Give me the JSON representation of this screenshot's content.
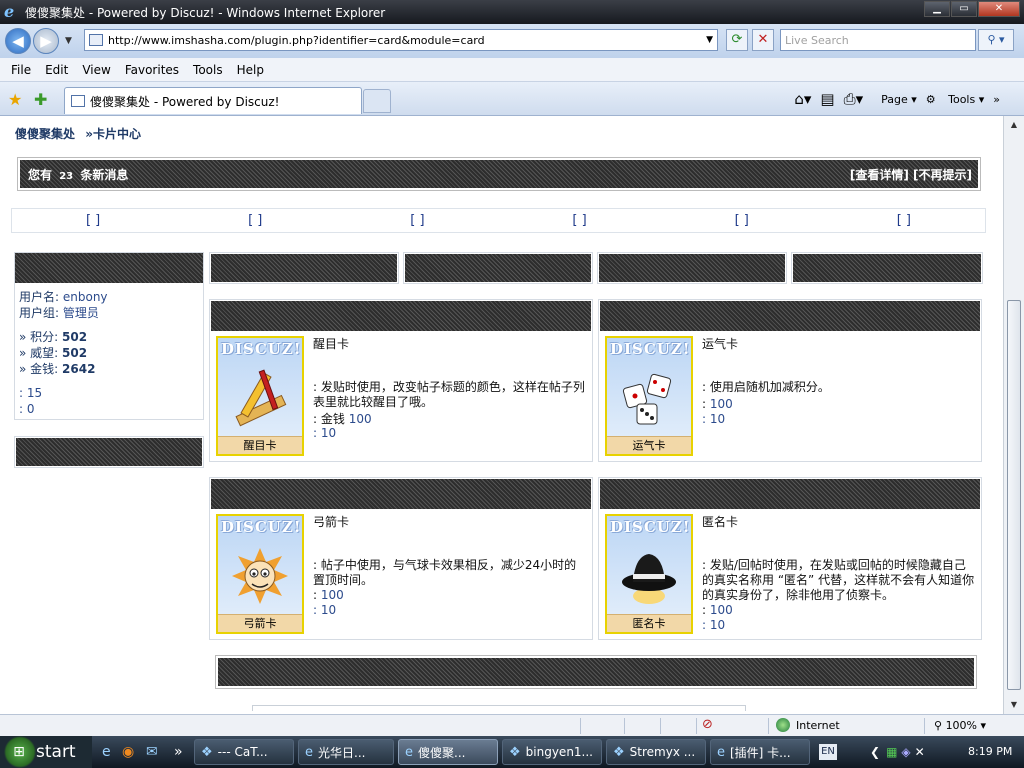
{
  "window": {
    "title": "傻傻聚集处 - Powered by Discuz! - Windows Internet Explorer"
  },
  "address": {
    "url": "http://www.imshasha.com/plugin.php?identifier=card&module=card",
    "search_placeholder": "Live Search"
  },
  "menu": [
    "File",
    "Edit",
    "View",
    "Favorites",
    "Tools",
    "Help"
  ],
  "tab": {
    "title": "傻傻聚集处 - Powered by Discuz!"
  },
  "commands": {
    "page": "Page",
    "tools": "Tools"
  },
  "breadcrumb": {
    "site": "傻傻聚集处",
    "page": "»卡片中心"
  },
  "message_bar": {
    "prefix": "您有",
    "count": "23",
    "suffix": "条新消息",
    "view": "[查看详情]",
    "dismiss": "[不再提示]"
  },
  "bracket_row": [
    "[ ]",
    "[ ]",
    "[ ]",
    "[ ]",
    "[ ]",
    "[ ]"
  ],
  "user": {
    "name_label": "用户名:",
    "name": "enbony",
    "group_label": "用户组:",
    "group": "管理员",
    "points_label": "» 积分:",
    "points": "502",
    "prestige_label": "» 威望:",
    "prestige": "502",
    "money_label": "» 金钱:",
    "money": "2642",
    "line1": ": 15",
    "line2": ": 0"
  },
  "cards": [
    {
      "name": "醒目卡",
      "image_label": "醒目卡",
      "art_icon": "pencil-ruler-icon",
      "description": ": 发贴时使用，改变帖子标题的颜色，这样在帖子列表里就比较醒目了哦。",
      "price_prefix": ": 金钱",
      "price": "100",
      "count": ": 10"
    },
    {
      "name": "运气卡",
      "image_label": "运气卡",
      "art_icon": "dice-icon",
      "description": ": 使用启随机加减积分。",
      "price_prefix": ":",
      "price": "100",
      "count": ": 10"
    },
    {
      "name": "弓箭卡",
      "image_label": "弓箭卡",
      "art_icon": "archer-face-icon",
      "description": ": 帖子中使用，与气球卡效果相反，减少24小时的置顶时间。",
      "price_prefix": ":",
      "price": "100",
      "count": ": 10"
    },
    {
      "name": "匿名卡",
      "image_label": "匿名卡",
      "art_icon": "hat-icon",
      "description": ": 发贴/回帖时使用，在发贴或回帖的时候隐藏自己的真实名称用 “匿名” 代替，这样就不会有人知道你的真实身份了，除非他用了侦察卡。",
      "price_prefix": ":",
      "price": "100",
      "count": ": 10"
    }
  ],
  "card_logo": "DISCUZ!",
  "status": {
    "zone": "Internet",
    "zoom": "100%"
  },
  "taskbar": {
    "start": "start",
    "buttons": [
      "--- CaT...",
      "光华日...",
      "傻傻聚...",
      "bingyen1...",
      "Stremyx ...",
      "[插件] 卡..."
    ],
    "lang": "EN",
    "clock": "8:19 PM"
  }
}
